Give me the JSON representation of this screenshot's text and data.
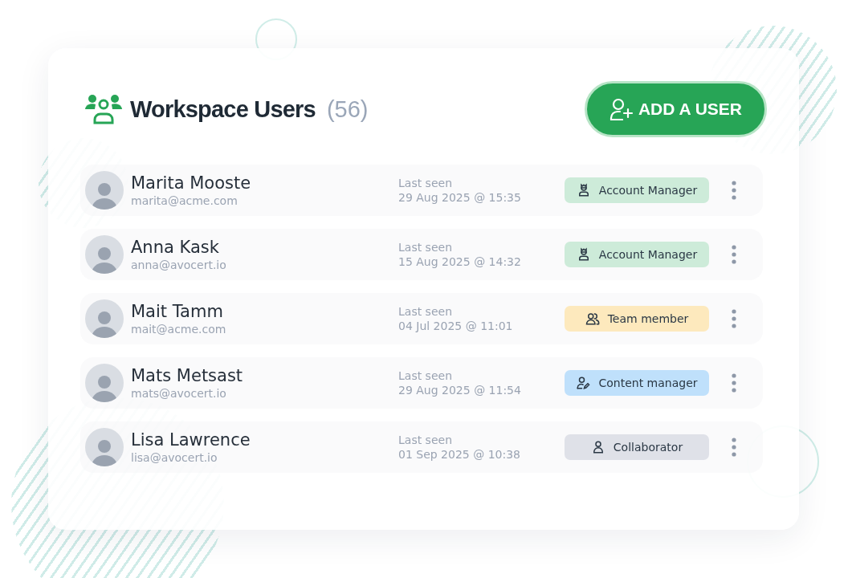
{
  "header": {
    "title": "Workspace Users",
    "count": "(56)",
    "add_button": "ADD A USER"
  },
  "users": [
    {
      "name": "Marita Mooste",
      "email": "marita@acme.com",
      "last_seen_label": "Last seen",
      "last_seen": "29 Aug 2025 @ 15:35",
      "role": {
        "label": "Account Manager",
        "kind": "account",
        "color": "#cdebd9"
      }
    },
    {
      "name": "Anna Kask",
      "email": "anna@avocert.io",
      "last_seen_label": "Last seen",
      "last_seen": "15 Aug 2025 @ 14:32",
      "role": {
        "label": "Account Manager",
        "kind": "account",
        "color": "#cdebd9"
      }
    },
    {
      "name": "Mait Tamm",
      "email": "mait@acme.com",
      "last_seen_label": "Last seen",
      "last_seen": "04 Jul 2025 @ 11:01",
      "role": {
        "label": "Team member",
        "kind": "team",
        "color": "#fde9bd"
      }
    },
    {
      "name": "Mats Metsast",
      "email": "mats@avocert.io",
      "last_seen_label": "Last seen",
      "last_seen": "29 Aug 2025 @ 11:54",
      "role": {
        "label": "Content manager",
        "kind": "content",
        "color": "#bfe0fb"
      }
    },
    {
      "name": "Lisa Lawrence",
      "email": "lisa@avocert.io",
      "last_seen_label": "Last seen",
      "last_seen": "01 Sep 2025 @ 10:38",
      "role": {
        "label": "Collaborator",
        "kind": "collaborator",
        "color": "#dfe1e8"
      }
    }
  ]
}
